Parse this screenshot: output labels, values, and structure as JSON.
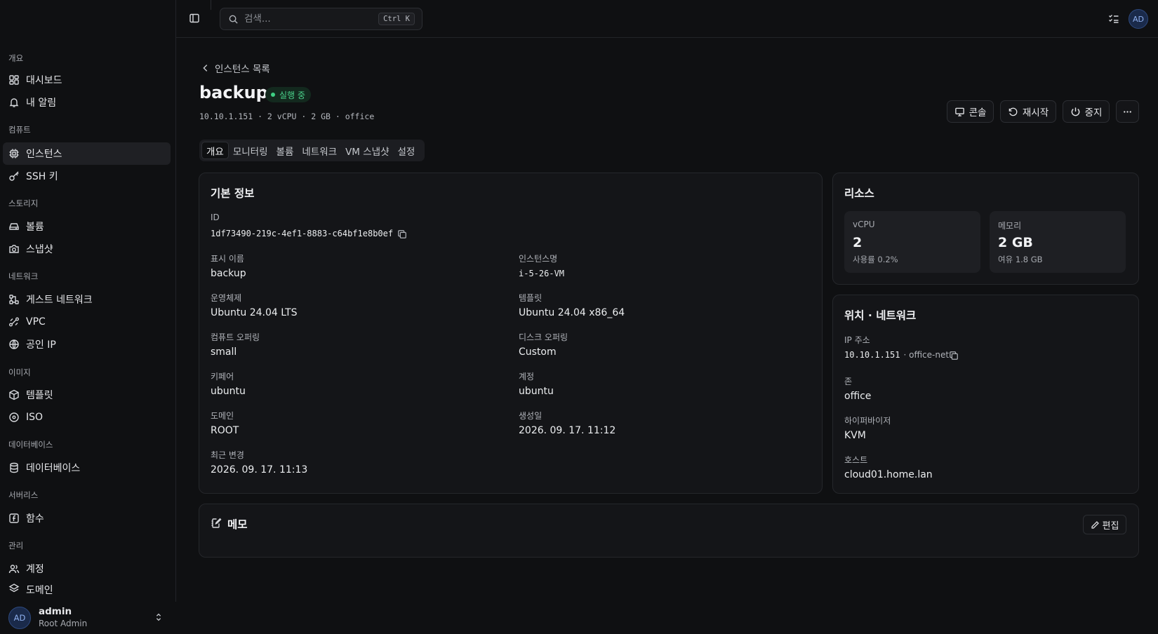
{
  "sidebar": {
    "groups": [
      {
        "label": "개요",
        "items": [
          {
            "label": "대시보드",
            "icon": "dashboard-icon"
          },
          {
            "label": "내 알림",
            "icon": "bell-icon"
          }
        ]
      },
      {
        "label": "컴퓨트",
        "items": [
          {
            "label": "인스턴스",
            "icon": "cpu-icon",
            "active": true
          },
          {
            "label": "SSH 키",
            "icon": "key-icon"
          }
        ]
      },
      {
        "label": "스토리지",
        "items": [
          {
            "label": "볼륨",
            "icon": "hard-drive-icon"
          },
          {
            "label": "스냅샷",
            "icon": "camera-icon"
          }
        ]
      },
      {
        "label": "네트워크",
        "items": [
          {
            "label": "게스트 네트워크",
            "icon": "network-icon"
          },
          {
            "label": "VPC",
            "icon": "route-icon"
          },
          {
            "label": "공인 IP",
            "icon": "globe-icon"
          }
        ]
      },
      {
        "label": "이미지",
        "items": [
          {
            "label": "템플릿",
            "icon": "package-icon"
          },
          {
            "label": "ISO",
            "icon": "disc-icon"
          }
        ]
      },
      {
        "label": "데이터베이스",
        "items": [
          {
            "label": "데이터베이스",
            "icon": "database-icon"
          }
        ]
      },
      {
        "label": "서버리스",
        "items": [
          {
            "label": "함수",
            "icon": "function-icon"
          }
        ]
      },
      {
        "label": "관리",
        "items": [
          {
            "label": "계정",
            "icon": "users-icon"
          },
          {
            "label": "도메인",
            "icon": "layers-icon"
          }
        ]
      }
    ],
    "user": {
      "initials": "AD",
      "name": "admin",
      "role": "Root Admin"
    }
  },
  "header": {
    "search_placeholder": "검색...",
    "search_shortcut": "Ctrl K",
    "avatar_initials": "AD"
  },
  "page": {
    "back_label": "인스턴스 목록",
    "title": "backup",
    "status": "실행 중",
    "subline": "10.10.1.151 · 2 vCPU · 2 GB · office",
    "actions": {
      "console": "콘솔",
      "restart": "재시작",
      "stop": "중지"
    },
    "tabs": [
      "개요",
      "모니터링",
      "볼륨",
      "네트워크",
      "VM 스냅샷",
      "설정"
    ],
    "active_tab": 0
  },
  "basic_info": {
    "title": "기본 정보",
    "id_label": "ID",
    "id_value": "1df73490-219c-4ef1-8883-c64bf1e8b0ef",
    "display_name_label": "표시 이름",
    "display_name_value": "backup",
    "instance_name_label": "인스턴스명",
    "instance_name_value": "i-5-26-VM",
    "os_label": "운영체제",
    "os_value": "Ubuntu 24.04 LTS",
    "template_label": "템플릿",
    "template_value": "Ubuntu 24.04 x86_64",
    "compute_label": "컴퓨트 오퍼링",
    "compute_value": "small",
    "disk_label": "디스크 오퍼링",
    "disk_value": "Custom",
    "keypair_label": "키페어",
    "keypair_value": "ubuntu",
    "account_label": "계정",
    "account_value": "ubuntu",
    "domain_label": "도메인",
    "domain_value": "ROOT",
    "created_label": "생성일",
    "created_value": "2026. 09. 17. 11:12",
    "modified_label": "최근 변경",
    "modified_value": "2026. 09. 17. 11:13"
  },
  "resources": {
    "title": "리소스",
    "vcpu_label": "vCPU",
    "vcpu_value": "2",
    "vcpu_usage": "사용률 0.2%",
    "memory_label": "메모리",
    "memory_value": "2 GB",
    "memory_free": "여유 1.8 GB"
  },
  "location": {
    "title": "위치 · 네트워크",
    "ip_label": "IP 주소",
    "ip_value": "10.10.1.151",
    "ip_network": "· office-net",
    "zone_label": "존",
    "zone_value": "office",
    "hypervisor_label": "하이퍼바이저",
    "hypervisor_value": "KVM",
    "host_label": "호스트",
    "host_value": "cloud01.home.lan"
  },
  "memo": {
    "title": "메모",
    "edit_label": "편집"
  }
}
